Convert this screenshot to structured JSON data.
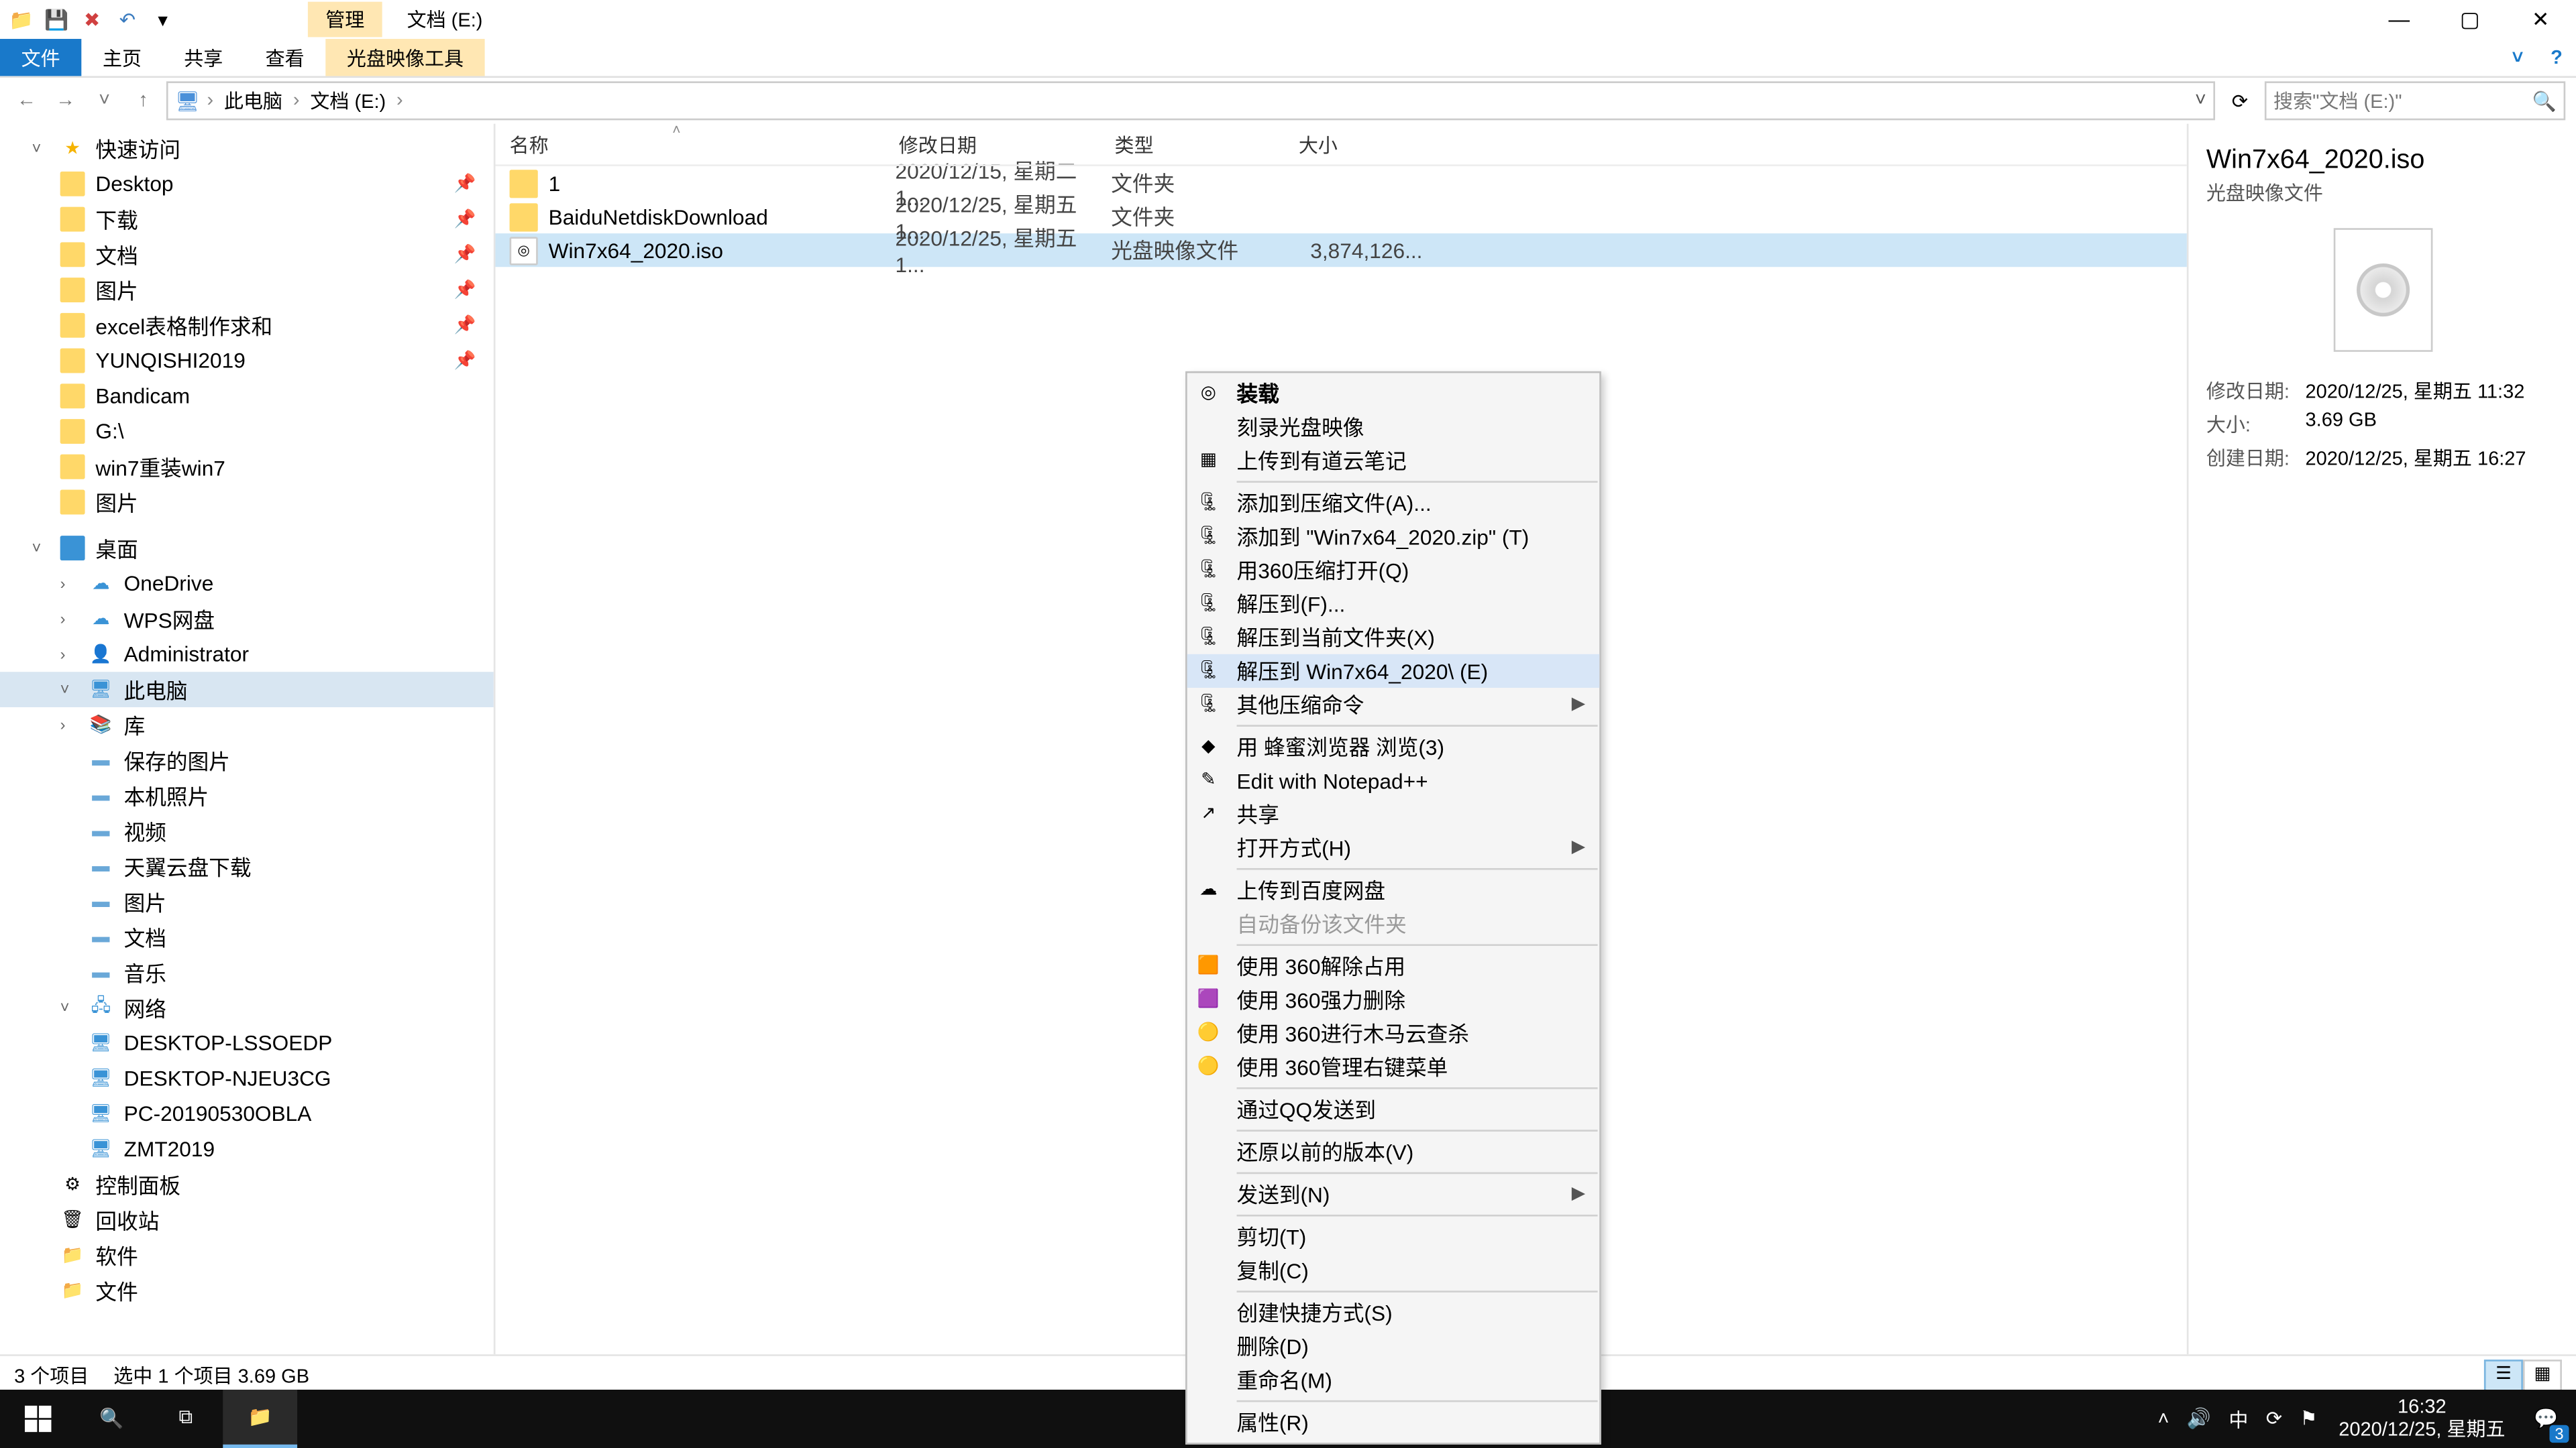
{
  "window": {
    "contextual_tab_group": "管理",
    "title": "文档 (E:)",
    "min": "—",
    "max": "▢",
    "close": "✕"
  },
  "qat": {
    "save": "💾",
    "delete": "✖",
    "undo": "↶",
    "drop": "▾"
  },
  "ribbon": {
    "file": "文件",
    "home": "主页",
    "share": "共享",
    "view": "查看",
    "disc_tool": "光盘映像工具"
  },
  "address": {
    "back": "←",
    "fwd": "→",
    "up": "↑",
    "crumbs": [
      "此电脑",
      "文档 (E:)"
    ],
    "refresh": "⟳",
    "search_placeholder": "搜索\"文档 (E:)\""
  },
  "nav": {
    "quick_access": "快速访问",
    "items_qa": [
      {
        "label": "Desktop",
        "pin": true
      },
      {
        "label": "下载",
        "pin": true
      },
      {
        "label": "文档",
        "pin": true
      },
      {
        "label": "图片",
        "pin": true
      },
      {
        "label": "excel表格制作求和",
        "pin": true
      },
      {
        "label": "YUNQISHI2019",
        "pin": true
      },
      {
        "label": "Bandicam"
      },
      {
        "label": "G:\\"
      },
      {
        "label": "win7重装win7"
      },
      {
        "label": "图片"
      }
    ],
    "desktop": "桌面",
    "items_dt": [
      {
        "label": "OneDrive",
        "icon": "cloud"
      },
      {
        "label": "WPS网盘",
        "icon": "cloud"
      },
      {
        "label": "Administrator",
        "icon": "user"
      },
      {
        "label": "此电脑",
        "icon": "pc",
        "selected": true
      },
      {
        "label": "库",
        "icon": "lib"
      }
    ],
    "items_lib": [
      {
        "label": "保存的图片"
      },
      {
        "label": "本机照片"
      },
      {
        "label": "视频"
      },
      {
        "label": "天翼云盘下载"
      },
      {
        "label": "图片"
      },
      {
        "label": "文档"
      },
      {
        "label": "音乐"
      }
    ],
    "network": "网络",
    "items_net": [
      {
        "label": "DESKTOP-LSSOEDP"
      },
      {
        "label": "DESKTOP-NJEU3CG"
      },
      {
        "label": "PC-20190530OBLA"
      },
      {
        "label": "ZMT2019"
      }
    ],
    "items_tail": [
      {
        "label": "控制面板",
        "icon": "cpl"
      },
      {
        "label": "回收站",
        "icon": "bin"
      },
      {
        "label": "软件",
        "icon": "folder"
      },
      {
        "label": "文件",
        "icon": "folder"
      }
    ]
  },
  "columns": {
    "name": "名称",
    "date": "修改日期",
    "type": "类型",
    "size": "大小"
  },
  "rows": [
    {
      "icon": "folder",
      "name": "1",
      "date": "2020/12/15, 星期二 1...",
      "type": "文件夹",
      "size": ""
    },
    {
      "icon": "folder",
      "name": "BaiduNetdiskDownload",
      "date": "2020/12/25, 星期五 1...",
      "type": "文件夹",
      "size": ""
    },
    {
      "icon": "iso",
      "name": "Win7x64_2020.iso",
      "date": "2020/12/25, 星期五 1...",
      "type": "光盘映像文件",
      "size": "3,874,126...",
      "selected": true
    }
  ],
  "context_menu": [
    {
      "label": "装载",
      "bold": true,
      "icon": "disc"
    },
    {
      "label": "刻录光盘映像"
    },
    {
      "label": "上传到有道云笔记",
      "icon": "blue"
    },
    {
      "sep": true
    },
    {
      "label": "添加到压缩文件(A)...",
      "icon": "zip"
    },
    {
      "label": "添加到 \"Win7x64_2020.zip\" (T)",
      "icon": "zip"
    },
    {
      "label": "用360压缩打开(Q)",
      "icon": "zip"
    },
    {
      "label": "解压到(F)...",
      "icon": "zip"
    },
    {
      "label": "解压到当前文件夹(X)",
      "icon": "zip"
    },
    {
      "label": "解压到 Win7x64_2020\\ (E)",
      "icon": "zip",
      "hover": true
    },
    {
      "label": "其他压缩命令",
      "icon": "zip",
      "arrow": true
    },
    {
      "sep": true
    },
    {
      "label": "用 蜂蜜浏览器 浏览(3)",
      "icon": "green"
    },
    {
      "label": "Edit with Notepad++",
      "icon": "npp"
    },
    {
      "label": "共享",
      "icon": "share"
    },
    {
      "label": "打开方式(H)",
      "arrow": true
    },
    {
      "sep": true
    },
    {
      "label": "上传到百度网盘",
      "icon": "baidu"
    },
    {
      "label": "自动备份该文件夹",
      "disabled": true
    },
    {
      "sep": true
    },
    {
      "label": "使用 360解除占用",
      "icon": "s360"
    },
    {
      "label": "使用 360强力删除",
      "icon": "s360p"
    },
    {
      "label": "使用 360进行木马云查杀",
      "icon": "s360y"
    },
    {
      "label": "使用 360管理右键菜单",
      "icon": "s360y"
    },
    {
      "sep": true
    },
    {
      "label": "通过QQ发送到"
    },
    {
      "sep": true
    },
    {
      "label": "还原以前的版本(V)"
    },
    {
      "sep": true
    },
    {
      "label": "发送到(N)",
      "arrow": true
    },
    {
      "sep": true
    },
    {
      "label": "剪切(T)"
    },
    {
      "label": "复制(C)"
    },
    {
      "sep": true
    },
    {
      "label": "创建快捷方式(S)"
    },
    {
      "label": "删除(D)"
    },
    {
      "label": "重命名(M)"
    },
    {
      "sep": true
    },
    {
      "label": "属性(R)"
    }
  ],
  "details": {
    "title": "Win7x64_2020.iso",
    "type": "光盘映像文件",
    "rows": [
      {
        "k": "修改日期:",
        "v": "2020/12/25, 星期五 11:32"
      },
      {
        "k": "大小:",
        "v": "3.69 GB"
      },
      {
        "k": "创建日期:",
        "v": "2020/12/25, 星期五 16:27"
      }
    ]
  },
  "status": {
    "count": "3 个项目",
    "sel": "选中 1 个项目  3.69 GB"
  },
  "taskbar": {
    "ime": "中",
    "time": "16:32",
    "date": "2020/12/25, 星期五",
    "notif_count": "3"
  }
}
